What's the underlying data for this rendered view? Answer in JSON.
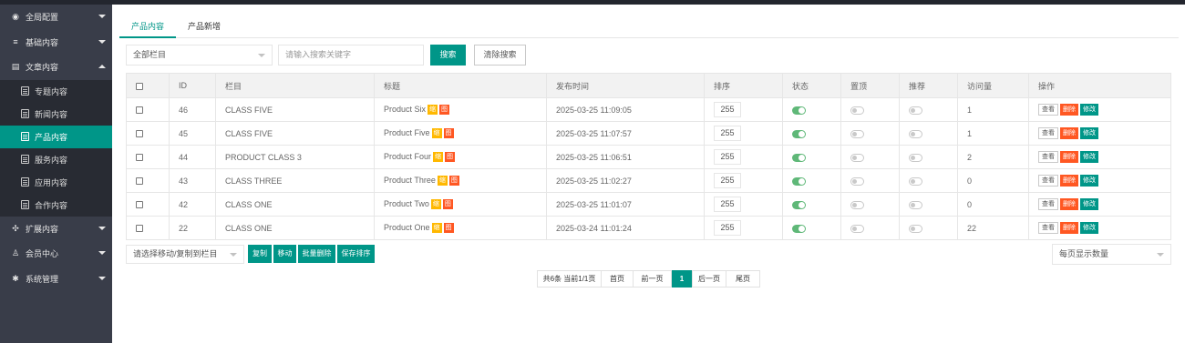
{
  "sidebar": {
    "groups": [
      {
        "label": "全局配置",
        "icon": "globe-icon",
        "glyph": "◉",
        "expanded": false
      },
      {
        "label": "基础内容",
        "icon": "sliders-icon",
        "glyph": "≡",
        "expanded": false
      },
      {
        "label": "文章内容",
        "icon": "document-icon",
        "glyph": "▤",
        "expanded": true
      },
      {
        "label": "扩展内容",
        "icon": "expand-icon",
        "glyph": "✣",
        "expanded": false
      },
      {
        "label": "会员中心",
        "icon": "user-icon",
        "glyph": "♙",
        "expanded": false
      },
      {
        "label": "系统管理",
        "icon": "gear-icon",
        "glyph": "✱",
        "expanded": false
      }
    ],
    "sub_items": [
      {
        "label": "专题内容",
        "active": false
      },
      {
        "label": "新闻内容",
        "active": false
      },
      {
        "label": "产品内容",
        "active": true
      },
      {
        "label": "服务内容",
        "active": false
      },
      {
        "label": "应用内容",
        "active": false
      },
      {
        "label": "合作内容",
        "active": false
      }
    ]
  },
  "tabs": [
    {
      "label": "产品内容",
      "active": true
    },
    {
      "label": "产品新增",
      "active": false
    }
  ],
  "search": {
    "category_value": "全部栏目",
    "keyword_placeholder": "请输入搜索关键字",
    "search_label": "搜索",
    "clear_label": "清除搜索"
  },
  "table": {
    "headers": [
      "",
      "ID",
      "栏目",
      "标题",
      "发布时间",
      "排序",
      "状态",
      "置顶",
      "推荐",
      "访问量",
      "操作"
    ],
    "tags": {
      "thumb": "缩",
      "img": "图"
    },
    "actions": {
      "view": "查看",
      "delete": "删除",
      "edit": "修改"
    },
    "rows": [
      {
        "id": "46",
        "category": "CLASS FIVE",
        "title": "Product Six",
        "time": "2025-03-25 11:09:05",
        "sort": "255",
        "status": true,
        "top": false,
        "recommend": false,
        "visits": "1"
      },
      {
        "id": "45",
        "category": "CLASS FIVE",
        "title": "Product Five",
        "time": "2025-03-25 11:07:57",
        "sort": "255",
        "status": true,
        "top": false,
        "recommend": false,
        "visits": "1"
      },
      {
        "id": "44",
        "category": "PRODUCT CLASS 3",
        "title": "Product Four",
        "time": "2025-03-25 11:06:51",
        "sort": "255",
        "status": true,
        "top": false,
        "recommend": false,
        "visits": "2"
      },
      {
        "id": "43",
        "category": "CLASS THREE",
        "title": "Product Three",
        "time": "2025-03-25 11:02:27",
        "sort": "255",
        "status": true,
        "top": false,
        "recommend": false,
        "visits": "0"
      },
      {
        "id": "42",
        "category": "CLASS ONE",
        "title": "Product Two",
        "time": "2025-03-25 11:01:07",
        "sort": "255",
        "status": true,
        "top": false,
        "recommend": false,
        "visits": "0"
      },
      {
        "id": "22",
        "category": "CLASS ONE",
        "title": "Product One",
        "time": "2025-03-24 11:01:24",
        "sort": "255",
        "status": true,
        "top": false,
        "recommend": false,
        "visits": "22"
      }
    ]
  },
  "batch": {
    "move_select": "请选择移动/复制到栏目",
    "copy": "复制",
    "move": "移动",
    "batch_delete": "批量删除",
    "save_sort": "保存排序",
    "page_size_select": "每页显示数量"
  },
  "pagination": {
    "summary": "共6条 当前1/1页",
    "first": "首页",
    "prev": "前一页",
    "current": "1",
    "next": "后一页",
    "last": "尾页"
  },
  "colors": {
    "accent": "#009688",
    "sidebar": "#393d49",
    "danger": "#ff5722",
    "warning": "#ffb800",
    "switch_on": "#5fb878"
  }
}
